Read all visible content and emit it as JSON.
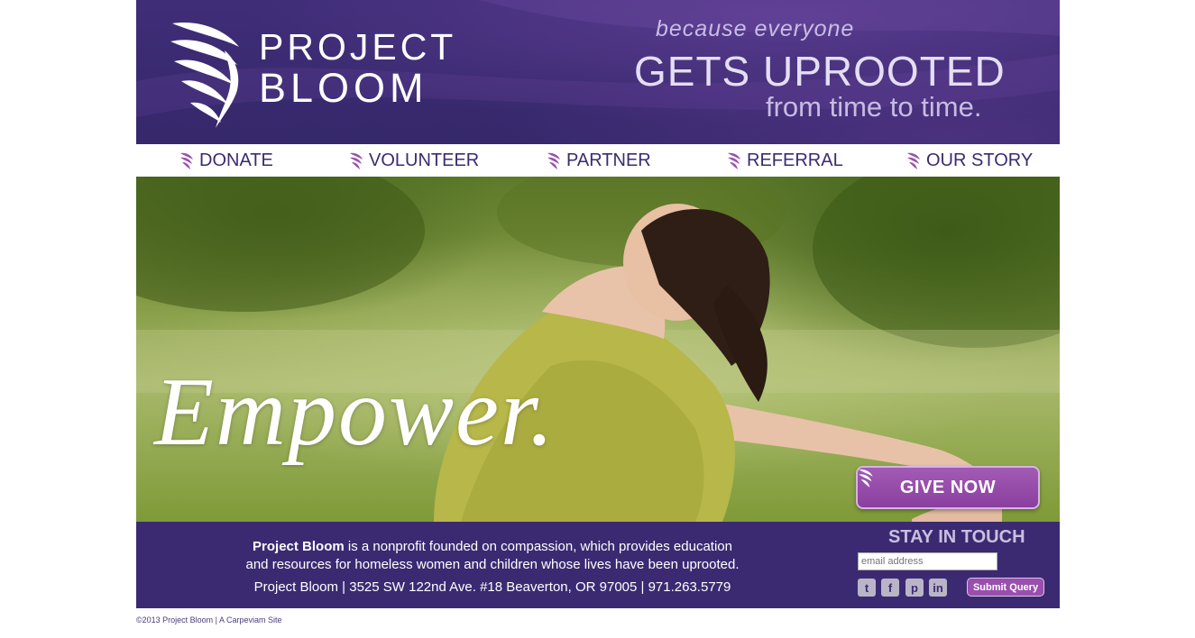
{
  "header": {
    "logo_line1": "PROJECT",
    "logo_line2": "BLOOM",
    "tagline_1": "because everyone",
    "tagline_2": "GETS UPROOTED",
    "tagline_3": "from time to time."
  },
  "nav": {
    "items": [
      {
        "label": "DONATE"
      },
      {
        "label": "VOLUNTEER"
      },
      {
        "label": "PARTNER"
      },
      {
        "label": "REFERRAL"
      },
      {
        "label": "OUR STORY"
      }
    ]
  },
  "hero": {
    "script_text": "Empower.",
    "cta_label": "GIVE NOW"
  },
  "footer": {
    "org_name": "Project Bloom",
    "about_line1_rest": " is a nonprofit founded on compassion, which provides education",
    "about_line2": "and resources for homeless women and children whose lives have been uprooted.",
    "address": "Project Bloom | 3525 SW 122nd Ave. #18 Beaverton, OR 97005 | 971.263.5779",
    "stay_title": "STAY IN TOUCH",
    "email_placeholder": "email address",
    "submit_label": "Submit Query",
    "social": [
      {
        "icon": "twitter-icon",
        "glyph": "t"
      },
      {
        "icon": "facebook-icon",
        "glyph": "f"
      },
      {
        "icon": "pinterest-icon",
        "glyph": "p"
      },
      {
        "icon": "linkedin-icon",
        "glyph": "in"
      }
    ]
  },
  "copyright": "©2013 Project Bloom | A Carpeviam Site",
  "colors": {
    "brand_purple": "#3b2a72",
    "accent_purple": "#9a4fae"
  }
}
